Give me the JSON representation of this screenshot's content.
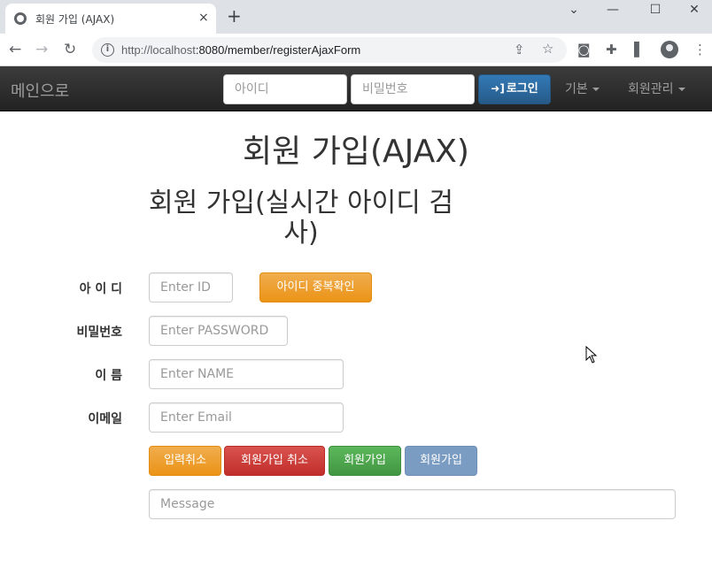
{
  "browser": {
    "tab_title": "회원 가입 (AJAX)",
    "tab_close": "×",
    "new_tab": "+",
    "url_host": "http://localhost",
    "url_rest": ":8080/member/registerAjaxForm",
    "window_controls": [
      "⌄",
      "—",
      "☐",
      "✕"
    ]
  },
  "navbar": {
    "brand": "메인으로",
    "id_placeholder": "아이디",
    "password_placeholder": "비밀번호",
    "login_label": "로그인",
    "dropdown_basic": "기본",
    "dropdown_member": "회원관리"
  },
  "page": {
    "title": "회원 가입(AJAX)",
    "subtitle": "회원 가입(실시간 아이디 검사)"
  },
  "form": {
    "id_label": "아 이 디",
    "id_placeholder": "Enter ID",
    "id_check_button": "아이디 중복확인",
    "password_label": "비밀번호",
    "password_placeholder": "Enter PASSWORD",
    "name_label": "이 름",
    "name_placeholder": "Enter NAME",
    "email_label": "이메일",
    "email_placeholder": "Enter Email",
    "reset_button": "입력취소",
    "cancel_button": "회원가입 취소",
    "submit_button": "회원가입",
    "submit_ajax_button": "회원가입",
    "message_placeholder": "Message"
  },
  "icons": {
    "back": "back-arrow-icon",
    "forward": "forward-arrow-icon",
    "reload": "reload-icon",
    "info": "site-info-icon",
    "share": "share-icon",
    "star": "bookmark-star-icon",
    "camera": "camera-icon",
    "extensions": "puzzle-icon",
    "sidepanel": "side-panel-icon",
    "profile": "profile-icon",
    "more": "more-vertical-icon",
    "login": "log-in-icon"
  },
  "colors": {
    "navbar": "#222222",
    "primary": "#337ab7",
    "warning": "#f0ad4e",
    "danger": "#d9534f",
    "success": "#5cb85c",
    "disabled": "#7a9cc2"
  }
}
